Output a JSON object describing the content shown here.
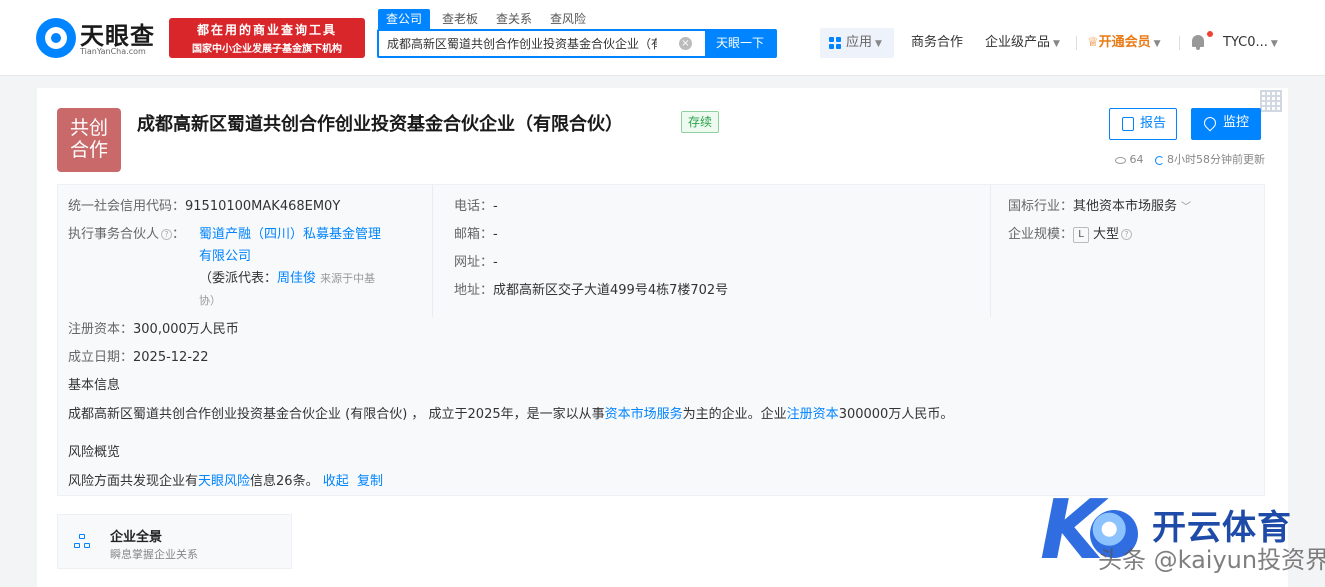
{
  "header": {
    "logo_title": "天眼查",
    "logo_sub": "TianYanCha.com",
    "slogan_line1": "都在用的商业查询工具",
    "slogan_line2": "国家中小企业发展子基金旗下机构",
    "search_tabs": [
      "查公司",
      "查老板",
      "查关系",
      "查风险"
    ],
    "search_value": "成都高新区蜀道共创合作创业投资基金合伙企业（有限",
    "search_button": "天眼一下",
    "nav": {
      "app": "应用",
      "business": "商务合作",
      "enterprise": "企业级产品",
      "vip": "开通会员",
      "user": "TYC0..."
    }
  },
  "company": {
    "logo_line1": "共创",
    "logo_line2": "合作",
    "name": "成都高新区蜀道共创合作创业投资基金合伙企业（有限合伙）",
    "status": "存续",
    "report_button": "报告",
    "monitor_button": "监控",
    "views": "64",
    "updated": "8小时58分钟前更新"
  },
  "info": {
    "credit_code_label": "统一社会信用代码：",
    "credit_code": "91510100MAK468EM0Y",
    "partner_label": "执行事务合伙人",
    "partner_line1": "蜀道产融（四川）私募基金管理",
    "partner_line2": "有限公司",
    "delegate_prefix": "（委派代表：",
    "delegate_name": "周佳俊",
    "delegate_source": "来源于中基",
    "delegate_suffix": "协）",
    "capital_label": "注册资本：",
    "capital": "300,000万人民币",
    "founded_label": "成立日期：",
    "founded": "2025-12-22",
    "phone_label": "电话：",
    "phone": "-",
    "email_label": "邮箱：",
    "email": "-",
    "website_label": "网址：",
    "website": "-",
    "address_label": "地址：",
    "address": "成都高新区交子大道499号4栋7楼702号",
    "industry_label": "国标行业：",
    "industry": "其他资本市场服务",
    "scale_label": "企业规模：",
    "scale_badge": "L",
    "scale": "大型",
    "basic_title": "基本信息",
    "basic_p1": "成都高新区蜀道共创合作创业投资基金合伙企业 (有限合伙) ， 成立于2025年，是一家以从事",
    "basic_link1": "资本市场服务",
    "basic_p2": "为主的企业。企业",
    "basic_link2": "注册资本",
    "basic_p3": "300000万人民币。",
    "risk_title": "风险概览",
    "risk_p1": "风险方面共发现企业有",
    "risk_link": "天眼风险",
    "risk_p2": "信息26条。",
    "collapse": "收起",
    "copy": "复制"
  },
  "panorama": {
    "title": "企业全景",
    "subtitle": "瞬息掌握企业关系"
  },
  "watermark": {
    "line1": "开云体育",
    "line2": "头条 @kaiyun投资界"
  }
}
